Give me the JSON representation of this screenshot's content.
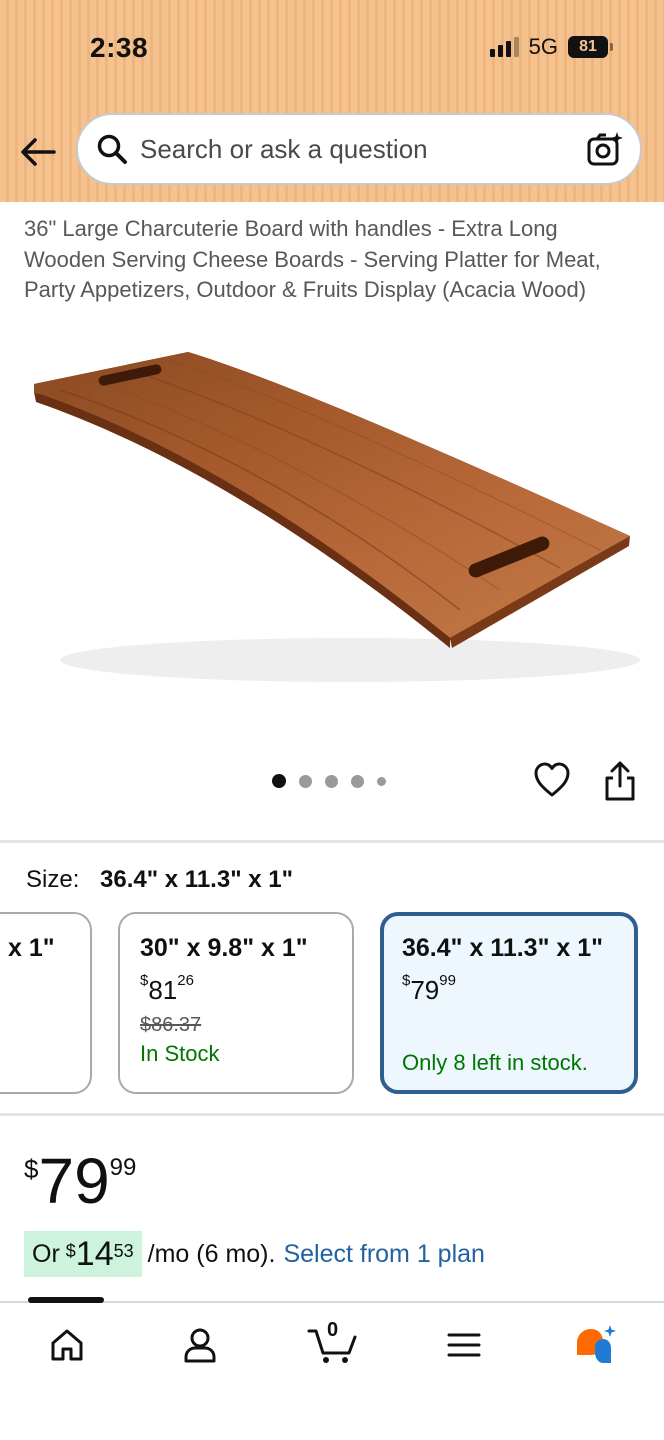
{
  "status_bar": {
    "time": "2:38",
    "network": "5G",
    "battery": "81"
  },
  "search": {
    "placeholder": "Search or ask a question"
  },
  "product": {
    "title": "36\" Large Charcuterie Board with handles - Extra Long Wooden Serving Cheese Boards - Serving Platter for Meat, Party Appetizers, Outdoor & Fruits Display (Acacia Wood)",
    "image_count": 5,
    "active_image": 1
  },
  "size": {
    "label": "Size:",
    "selected": "36.4\" x 11.3\" x 1\"",
    "options": [
      {
        "title": "x 1\""
      },
      {
        "title": "30\" x 9.8\" x 1\"",
        "price_currency": "$",
        "price_whole": "81",
        "price_fraction": "26",
        "list_price": "$86.37",
        "stock": "In Stock"
      },
      {
        "title": "36.4\" x 11.3\" x 1\"",
        "price_currency": "$",
        "price_whole": "79",
        "price_fraction": "99",
        "stock": "Only 8 left in stock."
      }
    ]
  },
  "price": {
    "currency": "$",
    "whole": "79",
    "fraction": "99"
  },
  "installment": {
    "prefix": "Or",
    "currency": "$",
    "whole": "14",
    "fraction": "53",
    "suffix": "/mo (6 mo).",
    "link": "Select from 1 plan"
  },
  "bottom_nav": {
    "cart_count": "0",
    "items": [
      "home",
      "account",
      "cart",
      "menu",
      "rufus"
    ]
  },
  "colors": {
    "header_bg": "#f4c28f",
    "link": "#2162a1",
    "in_stock": "#007600",
    "selected_border": "#2e5f8f",
    "selected_bg": "#edf7fd",
    "installment_bg": "#cdf2dd"
  }
}
